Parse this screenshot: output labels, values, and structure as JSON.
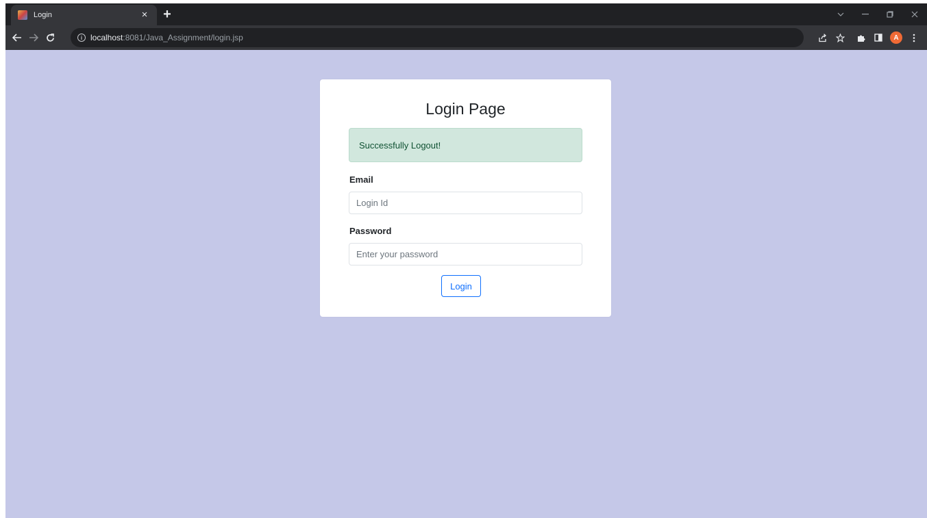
{
  "browser": {
    "tab_title": "Login",
    "tab_close": "×",
    "new_tab": "+",
    "url_host": "localhost",
    "url_rest": ":8081/Java_Assignment/login.jsp",
    "avatar_letter": "A"
  },
  "icons": {
    "back": "back-arrow-icon",
    "forward": "forward-arrow-icon",
    "reload": "reload-icon",
    "share": "share-icon",
    "bookmark": "star-icon",
    "extensions": "puzzle-icon",
    "side_panel": "side-panel-icon",
    "menu": "kebab-menu-icon"
  },
  "colors": {
    "page_background": "#c5c8e8",
    "alert_background": "#d1e7dd",
    "alert_text": "#0f5132",
    "button_accent": "#0d6efd",
    "avatar": "#f06a35"
  },
  "login": {
    "title": "Login Page",
    "alert_message": "Successfully Logout!",
    "email_label": "Email",
    "email_placeholder": "Login Id",
    "password_label": "Password",
    "password_placeholder": "Enter your password",
    "submit_label": "Login"
  }
}
